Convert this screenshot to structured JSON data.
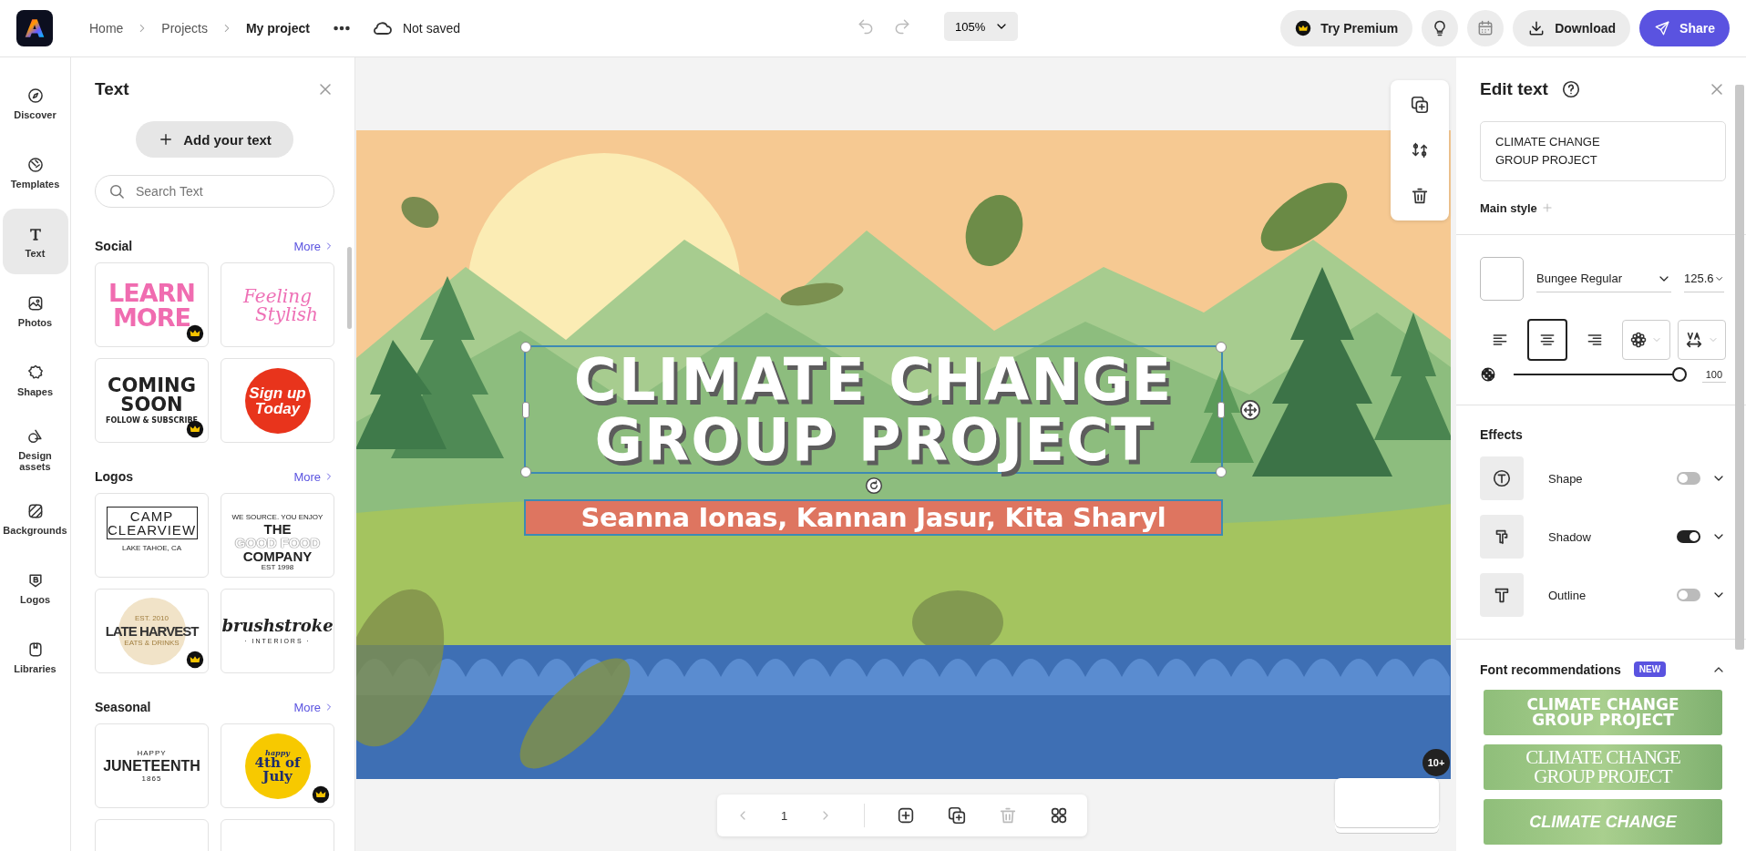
{
  "topbar": {
    "breadcrumb": [
      {
        "label": "Home",
        "current": false
      },
      {
        "label": "Projects",
        "current": false
      },
      {
        "label": "My project",
        "current": true
      }
    ],
    "save_status": "Not saved",
    "zoom": "105%",
    "premium_button": "Try Premium",
    "download_button": "Download",
    "share_button": "Share"
  },
  "rail": [
    {
      "label": "Discover",
      "selected": false
    },
    {
      "label": "Templates",
      "selected": false
    },
    {
      "label": "Text",
      "selected": true
    },
    {
      "label": "Photos",
      "selected": false
    },
    {
      "label": "Shapes",
      "selected": false
    },
    {
      "label": "Design assets",
      "selected": false
    },
    {
      "label": "Backgrounds",
      "selected": false
    },
    {
      "label": "Logos",
      "selected": false
    },
    {
      "label": "Libraries",
      "selected": false
    }
  ],
  "panel": {
    "title": "Text",
    "add_button": "Add your text",
    "search": {
      "placeholder": "Search Text"
    },
    "sections": [
      {
        "title": "Social",
        "more": "More",
        "thumbnails": [
          {
            "kind": "pink-bold",
            "premium": true,
            "lines": [
              "LEARN",
              "MORE"
            ]
          },
          {
            "kind": "script-pink",
            "premium": false,
            "lines": [
              "Feeling",
              "Stylish"
            ]
          },
          {
            "kind": "black-bold",
            "premium": true,
            "lines": [
              "COMING",
              "SOON",
              "FOLLOW & SUBSCRIBE"
            ]
          },
          {
            "kind": "red-badge",
            "premium": false,
            "lines": [
              "Sign up",
              "Today"
            ]
          }
        ]
      },
      {
        "title": "Logos",
        "more": "More",
        "thumbnails": [
          {
            "kind": "framed",
            "premium": false,
            "lines": [
              "CAMP",
              "CLEARVIEW",
              "LAKE TAHOE, CA"
            ]
          },
          {
            "kind": "outlined",
            "premium": false,
            "lines": [
              "WE SOURCE. YOU ENJOY",
              "THE",
              "GOOD FOOD",
              "COMPANY",
              "EST 1998"
            ]
          },
          {
            "kind": "circle-tan",
            "premium": true,
            "lines": [
              "EST. 2010",
              "LATE HARVEST",
              "EATS & DRINKS"
            ]
          },
          {
            "kind": "script-black",
            "premium": false,
            "lines": [
              "brushstroke",
              "· INTERIORS ·"
            ]
          }
        ]
      },
      {
        "title": "Seasonal",
        "more": "More",
        "thumbnails": [
          {
            "kind": "juneteenth",
            "premium": false,
            "lines": [
              "HAPPY",
              "JUNETEENTH",
              "1865"
            ]
          },
          {
            "kind": "yellow-badge",
            "premium": true,
            "lines": [
              "happy",
              "4th of",
              "July"
            ]
          },
          {
            "kind": "partial"
          },
          {
            "kind": "partial"
          }
        ]
      }
    ]
  },
  "canvas": {
    "selected": true,
    "title_lines": [
      "CLIMATE CHANGE",
      "GROUP PROJECT"
    ],
    "subtitle": "Seanna Ionas, Kannan Jasur, Kita Sharyl",
    "page": "1",
    "pages_badge": "10+"
  },
  "edit_panel": {
    "title": "Edit text",
    "text_value": "CLIMATE CHANGE\nGROUP PROJECT",
    "main_style": "Main style",
    "font": "Bungee Regular",
    "size": "125.6",
    "alignment": [
      {
        "kind": "left",
        "selected": false
      },
      {
        "kind": "center",
        "selected": true
      },
      {
        "kind": "right",
        "selected": false
      }
    ],
    "opacity": {
      "level": 1,
      "reading": "100"
    },
    "effects_title": "Effects",
    "effects": [
      {
        "label": "Shape",
        "on": false
      },
      {
        "label": "Shadow",
        "on": true
      },
      {
        "label": "Outline",
        "on": false
      }
    ],
    "recommendations": {
      "title": "Font recommendations",
      "badge": "NEW",
      "expanded": true,
      "items": [
        {
          "kind": "bold",
          "lines": [
            "CLIMATE CHANGE",
            "GROUP PROJECT"
          ]
        },
        {
          "kind": "condensed",
          "lines": [
            "CLIMATE CHANGE",
            "GROUP PROJECT"
          ]
        },
        {
          "kind": "italic",
          "lines": [
            "CLIMATE CHANGE"
          ]
        }
      ]
    }
  }
}
